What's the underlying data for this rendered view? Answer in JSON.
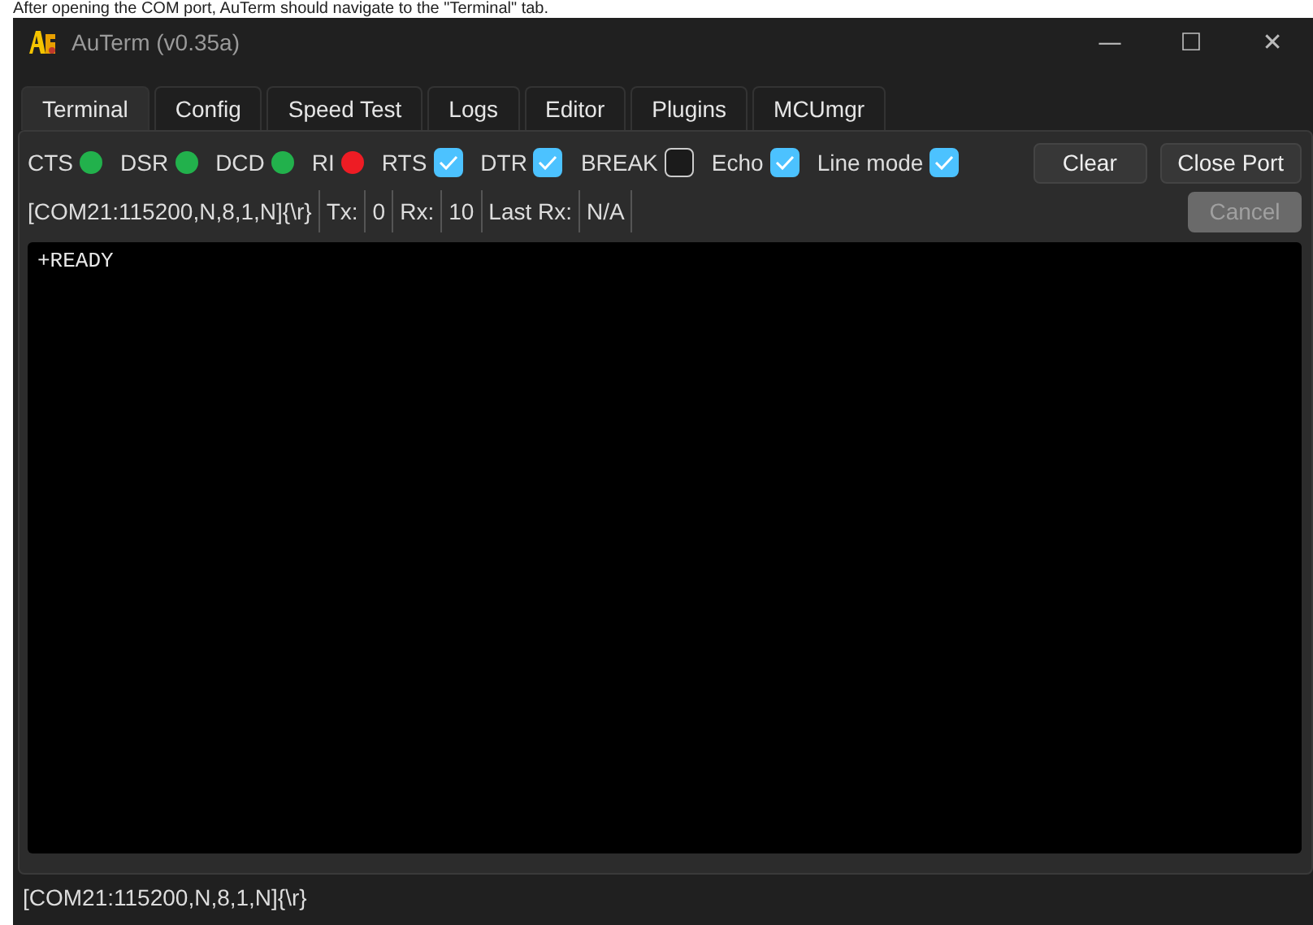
{
  "caption": "After opening the COM port, AuTerm should navigate to the \"Terminal\" tab.",
  "window": {
    "title": "AuTerm (v0.35a)",
    "controls": [
      "—",
      "☐",
      "✕"
    ]
  },
  "tabs": [
    {
      "label": "Terminal",
      "selected": true
    },
    {
      "label": "Config",
      "selected": false
    },
    {
      "label": "Speed Test",
      "selected": false
    },
    {
      "label": "Logs",
      "selected": false
    },
    {
      "label": "Editor",
      "selected": false
    },
    {
      "label": "Plugins",
      "selected": false
    },
    {
      "label": "MCUmgr",
      "selected": false
    }
  ],
  "signals": [
    {
      "kind": "led",
      "label": "CTS",
      "color": "#22b14c"
    },
    {
      "kind": "led",
      "label": "DSR",
      "color": "#22b14c"
    },
    {
      "kind": "led",
      "label": "DCD",
      "color": "#22b14c"
    },
    {
      "kind": "led",
      "label": "RI",
      "color": "#ee1c24"
    },
    {
      "kind": "checkbox",
      "label": "RTS",
      "checked": true
    },
    {
      "kind": "checkbox",
      "label": "DTR",
      "checked": true
    },
    {
      "kind": "checkbox",
      "label": "BREAK",
      "checked": false
    },
    {
      "kind": "checkbox",
      "label": "Echo",
      "checked": true
    },
    {
      "kind": "checkbox",
      "label": "Line mode",
      "checked": true
    }
  ],
  "buttons": [
    {
      "label": "Clear",
      "disabled": false
    },
    {
      "label": "Close Port",
      "disabled": false
    }
  ],
  "info": [
    "[COM21:115200,N,8,1,N]{\\r}",
    "Tx:",
    "0",
    "Rx:",
    "10",
    "Last Rx:",
    "N/A"
  ],
  "cancel": {
    "label": "Cancel",
    "disabled": true
  },
  "terminal": {
    "text": "+READY"
  },
  "status_bar": "[COM21:115200,N,8,1,N]{\\r}"
}
